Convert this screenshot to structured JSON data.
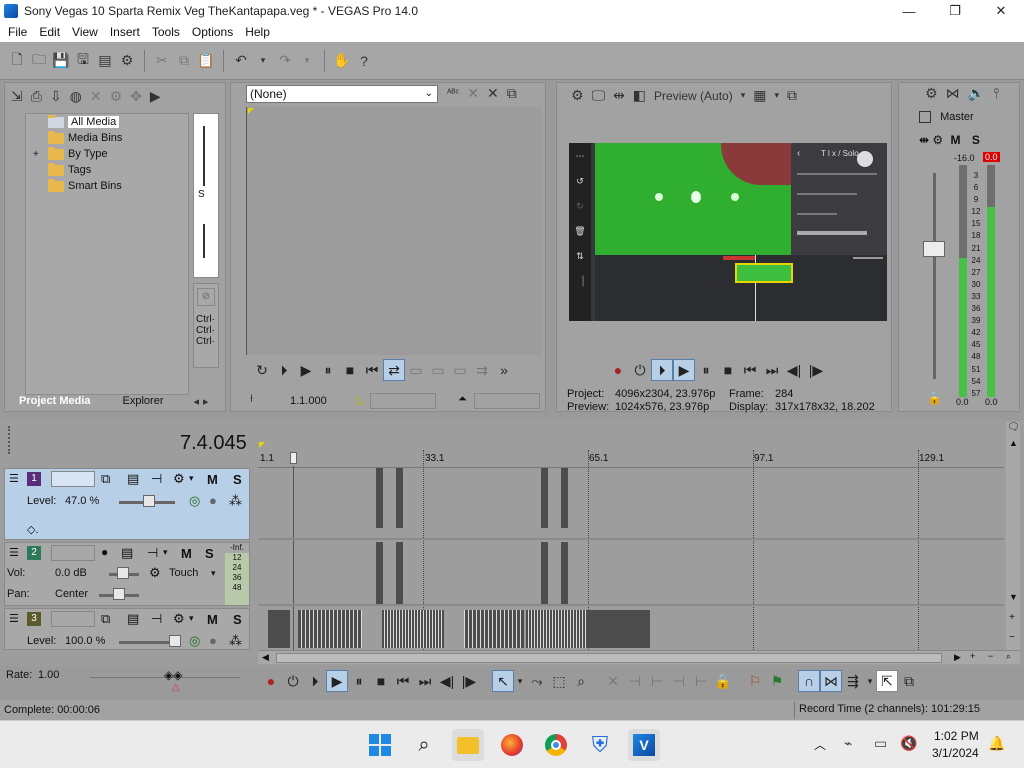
{
  "window": {
    "title": "Sony Vegas 10 Sparta Remix Veg TheKantapapa.veg * - VEGAS Pro 14.0",
    "minimize": "—",
    "maximize": "❐",
    "close": "✕"
  },
  "menu": [
    "File",
    "Edit",
    "View",
    "Insert",
    "Tools",
    "Options",
    "Help"
  ],
  "project_media": {
    "tree": [
      "All Media",
      "Media Bins",
      "By Type",
      "Tags",
      "Smart Bins"
    ],
    "expander": "+",
    "tabs": {
      "active": "Project Media",
      "other": "Explorer"
    },
    "side_labels": [
      "Ctrl·",
      "Ctrl·",
      "Ctrl·"
    ],
    "side_s": "S"
  },
  "trimmer": {
    "select_value": "(None)",
    "time": "1.1.000"
  },
  "preview": {
    "mode": "Preview (Auto)",
    "project_label": "Project:",
    "project_value": "4096x2304, 23.976p",
    "preview_label": "Preview:",
    "preview_value": "1024x576, 23.976p",
    "frame_label": "Frame:",
    "frame_value": "284",
    "display_label": "Display:",
    "display_value": "317x178x32, 18.202",
    "screen_header": "T l x / Solo"
  },
  "master": {
    "title": "Master",
    "m": "M",
    "s": "S",
    "level_left": "-16.0",
    "level_right": "0.0",
    "scale": [
      "3",
      "6",
      "9",
      "12",
      "15",
      "18",
      "21",
      "24",
      "27",
      "30",
      "33",
      "36",
      "39",
      "42",
      "45",
      "48",
      "51",
      "54",
      "57"
    ],
    "bottom_left": "0.0",
    "bottom_right": "0.0",
    "left_meter_level": 0.6,
    "right_meter_level": 0.82
  },
  "timeline": {
    "timecode": "7.4.045",
    "ruler": [
      "1.1",
      "33.1",
      "65.1",
      "97.1",
      "129.1"
    ],
    "tracks": [
      {
        "num": "1",
        "level_label": "Level:",
        "level_value": "47.0 %",
        "m": "M",
        "s": "S",
        "level": 0.47
      },
      {
        "num": "2",
        "vol_label": "Vol:",
        "vol_value": "0.0 dB",
        "pan_label": "Pan:",
        "pan_value": "Center",
        "mode": "Touch",
        "m": "M",
        "s": "S",
        "meter": [
          "-Inf.",
          "12",
          "24",
          "36",
          "48"
        ]
      },
      {
        "num": "3",
        "level_label": "Level:",
        "level_value": "100.0 %",
        "m": "M",
        "s": "S",
        "level": 1.0
      }
    ]
  },
  "rate": {
    "label": "Rate:",
    "value": "1.00"
  },
  "status": {
    "complete": "Complete: 00:00:06",
    "record": "Record Time (2 channels): 101:29:15"
  },
  "taskbar": {
    "time": "1:02 PM",
    "date": "3/1/2024"
  },
  "colors": {
    "accent_blue": "#b8cfe8",
    "meter_green": "#46c046",
    "clip_dark": "#4d4d4d",
    "green_screen": "#2fae2f"
  }
}
